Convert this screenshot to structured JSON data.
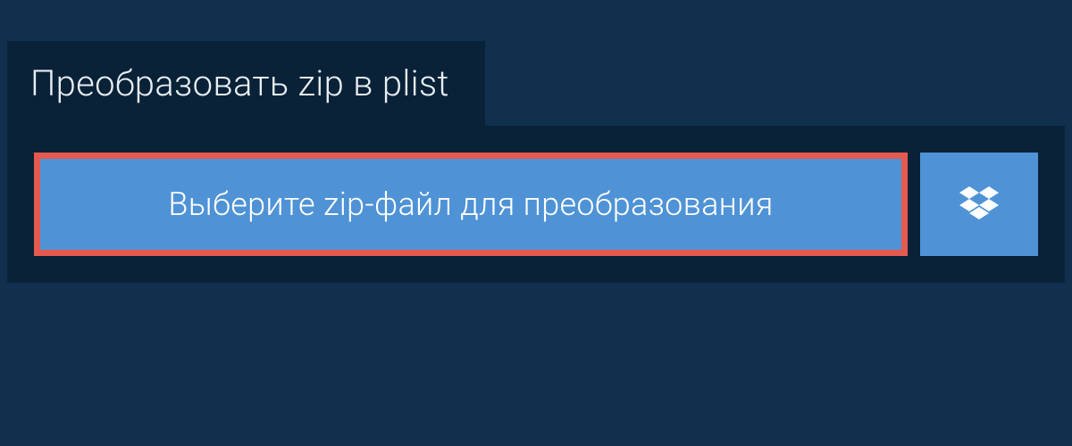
{
  "header": {
    "title": "Преобразовать zip в plist"
  },
  "upload": {
    "select_file_label": "Выберите zip-файл для преобразования"
  },
  "colors": {
    "bg_main": "#10304e",
    "bg_panel": "#0a2237",
    "button_primary": "#4f93d6",
    "highlight_border": "#e55a4f",
    "text_light": "#e8eef4",
    "text_white": "#ffffff"
  }
}
